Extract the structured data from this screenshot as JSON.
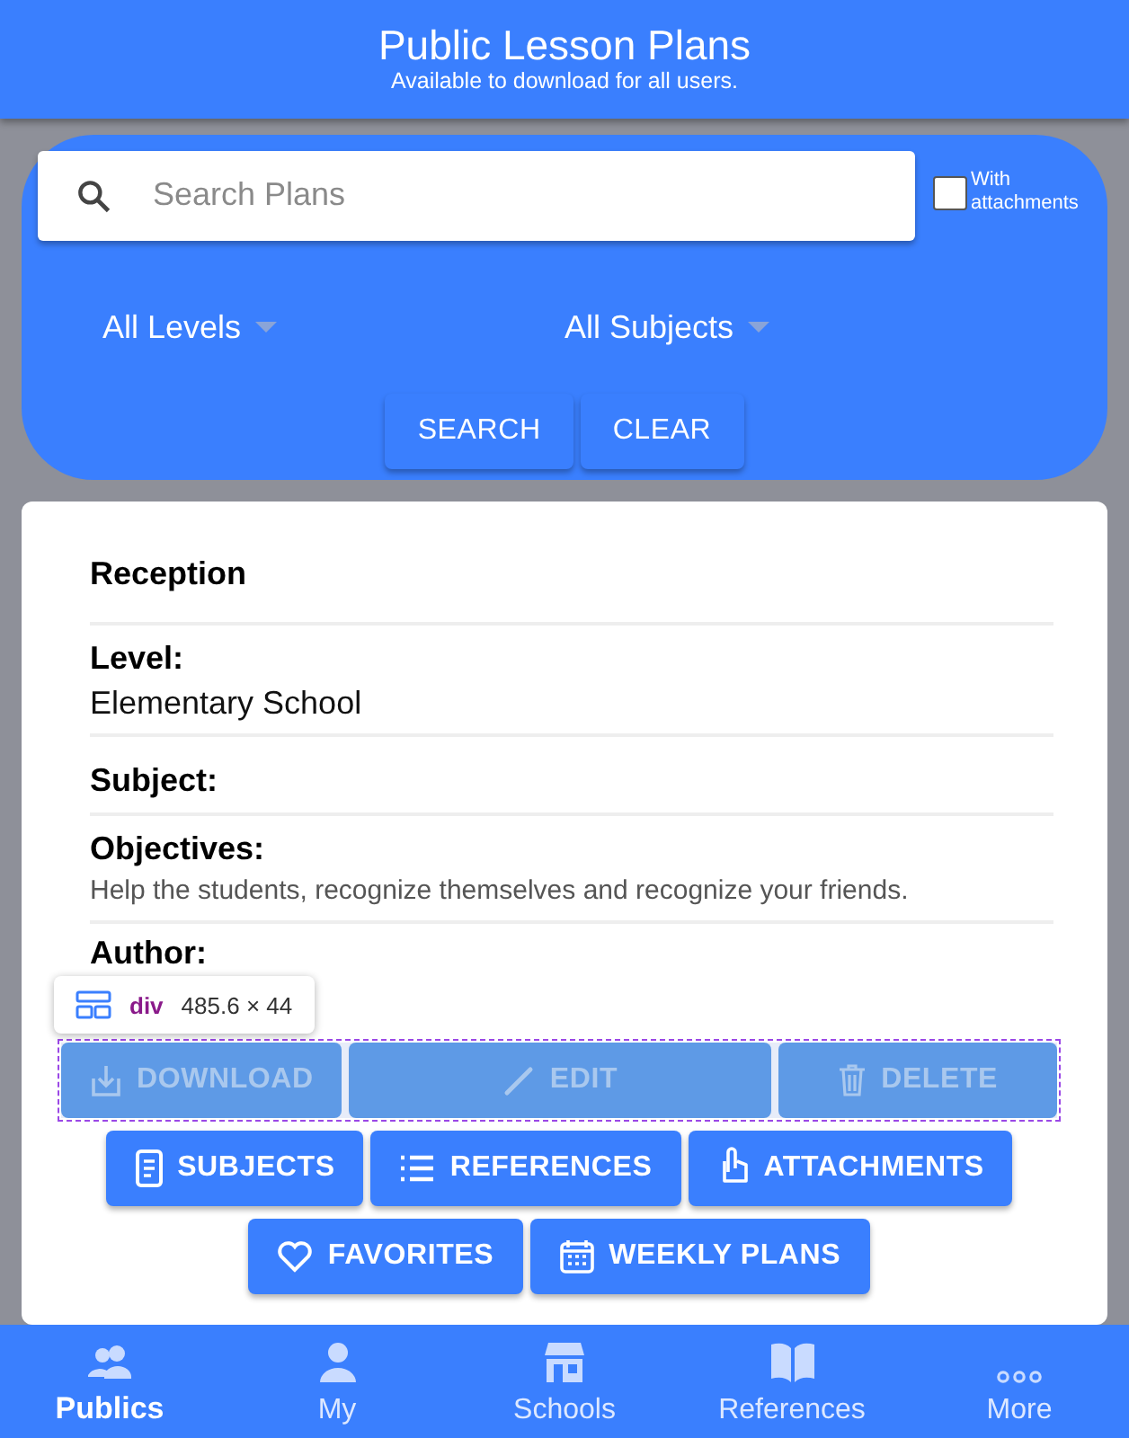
{
  "header": {
    "title": "Public Lesson Plans",
    "subtitle": "Available to download for all users."
  },
  "filters": {
    "search": {
      "placeholder": "Search Plans"
    },
    "with_attachments": {
      "label": "With attachments",
      "checked": false
    },
    "dropdowns": [
      "All Levels",
      "All Subjects"
    ],
    "buttons": [
      "SEARCH",
      "CLEAR"
    ]
  },
  "plan": {
    "title": "Reception",
    "fields": [
      {
        "label": "Level:",
        "value": "Elementary School",
        "kind": "large"
      },
      {
        "label": "Subject:"
      },
      {
        "label": "Objectives:",
        "value": "Help the students, recognize themselves and recognize your friends.",
        "kind": "small"
      },
      {
        "label": "Author:"
      }
    ]
  },
  "actions": [
    [
      {
        "label": "DOWNLOAD",
        "disabled": true
      },
      {
        "label": "EDIT",
        "disabled": true
      },
      {
        "label": "DELETE",
        "disabled": true
      }
    ],
    [
      {
        "label": "SUBJECTS",
        "disabled": false
      },
      {
        "label": "REFERENCES",
        "disabled": false
      },
      {
        "label": "ATTACHMENTS",
        "disabled": false
      }
    ],
    [
      {
        "label": "FAVORITES",
        "disabled": false
      },
      {
        "label": "WEEKLY PLANS",
        "disabled": false
      }
    ]
  ],
  "inspector": {
    "tag": "div",
    "size": "485.6 × 44"
  },
  "nav": [
    {
      "label": "Publics",
      "selected": true
    },
    {
      "label": "My",
      "selected": false
    },
    {
      "label": "Schools",
      "selected": false
    },
    {
      "label": "References",
      "selected": false
    },
    {
      "label": "More",
      "selected": false
    }
  ]
}
